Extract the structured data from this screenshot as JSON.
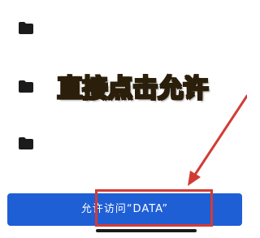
{
  "annotation": {
    "text": "直接点击允许",
    "text_color": "#f6e06a",
    "outline_color": "#2b1f0b"
  },
  "file_list": {
    "items": [
      {
        "icon": "folder-icon"
      },
      {
        "icon": "folder-icon"
      },
      {
        "icon": "folder-icon"
      }
    ]
  },
  "allow_button": {
    "label": "允许访问“DATA”",
    "color": "#1f5fd6"
  },
  "highlight": {
    "color": "#d23b34"
  }
}
